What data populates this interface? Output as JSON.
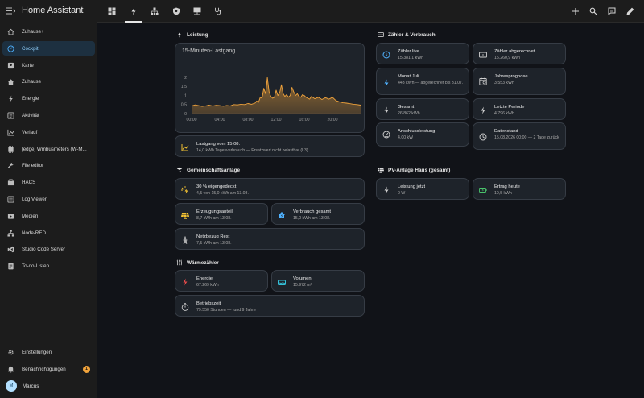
{
  "app_title": "Home Assistant",
  "sidebar": {
    "items": [
      {
        "label": "Zuhause+",
        "icon": "home-outline-icon",
        "active": false
      },
      {
        "label": "Cockpit",
        "icon": "gauge-icon",
        "active": true
      },
      {
        "label": "Karte",
        "icon": "account-box-icon",
        "active": false
      },
      {
        "label": "Zuhause",
        "icon": "home-icon",
        "active": false
      },
      {
        "label": "Energie",
        "icon": "lightning-icon",
        "active": false
      },
      {
        "label": "Aktivität",
        "icon": "list-icon",
        "active": false
      },
      {
        "label": "Verlauf",
        "icon": "chart-icon",
        "active": false
      },
      {
        "label": "[edge] Wmbusmeters (W-M...",
        "icon": "module-icon",
        "active": false
      },
      {
        "label": "File editor",
        "icon": "wrench-icon",
        "active": false
      },
      {
        "label": "HACS",
        "icon": "hacs-icon",
        "active": false
      },
      {
        "label": "Log Viewer",
        "icon": "log-icon",
        "active": false
      },
      {
        "label": "Medien",
        "icon": "media-icon",
        "active": false
      },
      {
        "label": "Node-RED",
        "icon": "sitemap-icon",
        "active": false
      },
      {
        "label": "Studio Code Server",
        "icon": "code-icon",
        "active": false
      },
      {
        "label": "To-do-Listen",
        "icon": "todo-icon",
        "active": false
      }
    ],
    "settings_label": "Einstellungen",
    "notifications_label": "Benachrichtigungen",
    "notifications_count": "1",
    "user_initial": "M",
    "user_name": "Marcus"
  },
  "topbar": {
    "tabs": [
      "grid-view-icon",
      "lightning-icon",
      "network-icon",
      "shield-icon",
      "server-icon",
      "stethoscope-icon"
    ],
    "active_tab": 1,
    "actions": [
      "plus-icon",
      "search-icon",
      "chat-icon",
      "pencil-icon"
    ]
  },
  "sections": {
    "leistung": "Leistung",
    "zaehler": "Zähler & Verbrauch",
    "gemeinschaft": "Gemeinschaftsanlage",
    "pv": "PV-Anlage Haus (gesamt)",
    "waerme": "Wärmezähler"
  },
  "chart": {
    "title": "15-Minuten-Lastgang"
  },
  "chart_data": {
    "type": "area",
    "x_ticks": [
      "00:00",
      "04:00",
      "08:00",
      "12:00",
      "16:00",
      "20:00"
    ],
    "y_ticks": [
      "0",
      "0,5",
      "1",
      "1,5",
      "2"
    ],
    "ylim": [
      0,
      2.5
    ],
    "x_hours": [
      0,
      0.5,
      1,
      1.5,
      2,
      2.5,
      3,
      3.5,
      4,
      4.5,
      5,
      5.5,
      6,
      6.5,
      7,
      7.5,
      8,
      8.5,
      9,
      9.25,
      9.5,
      9.75,
      10,
      10.25,
      10.5,
      10.75,
      11,
      11.25,
      11.5,
      11.75,
      12,
      12.25,
      12.5,
      12.75,
      13,
      13.25,
      13.5,
      13.75,
      14,
      14.25,
      14.5,
      14.75,
      15,
      15.25,
      15.5,
      15.75,
      16,
      16.25,
      16.5,
      16.75,
      17,
      17.5,
      18,
      18.5,
      19,
      19.5,
      20,
      20.5,
      21,
      21.5,
      22,
      22.5,
      23,
      23.5,
      24
    ],
    "values": [
      0.42,
      0.48,
      0.44,
      0.4,
      0.43,
      0.47,
      0.42,
      0.46,
      0.44,
      0.41,
      0.45,
      0.43,
      0.5,
      0.48,
      0.52,
      0.5,
      0.56,
      0.52,
      0.58,
      0.7,
      0.62,
      0.9,
      0.85,
      1.4,
      1.1,
      2.0,
      1.2,
      0.95,
      0.85,
      0.9,
      1.3,
      1.0,
      1.15,
      1.6,
      1.1,
      0.95,
      1.05,
      0.9,
      1.0,
      1.45,
      1.2,
      1.0,
      1.1,
      0.95,
      0.9,
      1.05,
      1.0,
      0.9,
      0.85,
      0.8,
      0.95,
      0.82,
      0.9,
      0.78,
      0.88,
      0.8,
      0.9,
      0.72,
      0.65,
      0.6,
      0.58,
      0.55,
      0.52,
      0.5,
      0.47
    ],
    "color": "#f1a33b"
  },
  "lastgang": {
    "name": "Lastgang vom 15.08.",
    "value": "14,0 kWh Tagesverbrauch — Ersatzwert nicht belastbar (L3)"
  },
  "zaehler_tiles": [
    {
      "name": "Zähler live",
      "value": "15.381,1 kWh",
      "icon": "meter-live-icon"
    },
    {
      "name": "Zähler abgerechnet",
      "value": "15.260,9 kWh",
      "icon": "counter-icon"
    },
    {
      "name": "Monat Juli",
      "value": "443 kWh — abgerechnet bis 31.07.",
      "icon": "lightning-icon"
    },
    {
      "name": "Jahresprognose",
      "value": "3.553 kWh",
      "icon": "calendar-icon"
    },
    {
      "name": "Gesamt",
      "value": "26.862 kWh",
      "icon": "lightning-icon"
    },
    {
      "name": "Letzte Periode",
      "value": "4.796 kWh",
      "icon": "lightning-icon"
    },
    {
      "name": "Anschlussleistung",
      "value": "4,00 kW",
      "icon": "speedometer-icon"
    },
    {
      "name": "Datenstand",
      "value": "15.08.2026 00:00 — 2 Tage zurück",
      "icon": "clock-icon"
    }
  ],
  "gemeinschaft_tiles": [
    {
      "name": "30 % eigengedeckt",
      "value": "4,5 von 15,0 kWh am 13.08.",
      "icon": "solar-lightning-icon"
    },
    {
      "name": "Erzeugungsanteil",
      "value": "8,7 kWh am 13.08.",
      "icon": "solar-panel-icon"
    },
    {
      "name": "Verbrauch gesamt",
      "value": "15,0 kWh am 13.08.",
      "icon": "home-lightning-icon"
    },
    {
      "name": "Netzbezug Rest",
      "value": "7,5 kWh am 13.08.",
      "icon": "transmission-tower-icon"
    }
  ],
  "pv_tiles": [
    {
      "name": "Leistung jetzt",
      "value": "0 W",
      "icon": "lightning-icon"
    },
    {
      "name": "Ertrag heute",
      "value": "10,5 kWh",
      "icon": "battery-charging-icon"
    }
  ],
  "waerme_tiles": [
    {
      "name": "Energie",
      "value": "67.269 kWh",
      "icon": "lightning-icon"
    },
    {
      "name": "Volumen",
      "value": "15.972 m³",
      "icon": "water-icon"
    },
    {
      "name": "Betriebszeit",
      "value": "79.550 Stunden — rund 9 Jahre",
      "icon": "timer-icon"
    }
  ],
  "colors": {
    "accent": "#4fb2ff",
    "amber": "#f1a33b",
    "red": "#e84a4a",
    "green": "#49c26b",
    "yellow": "#f2c233",
    "cyan": "#34c0d8"
  }
}
